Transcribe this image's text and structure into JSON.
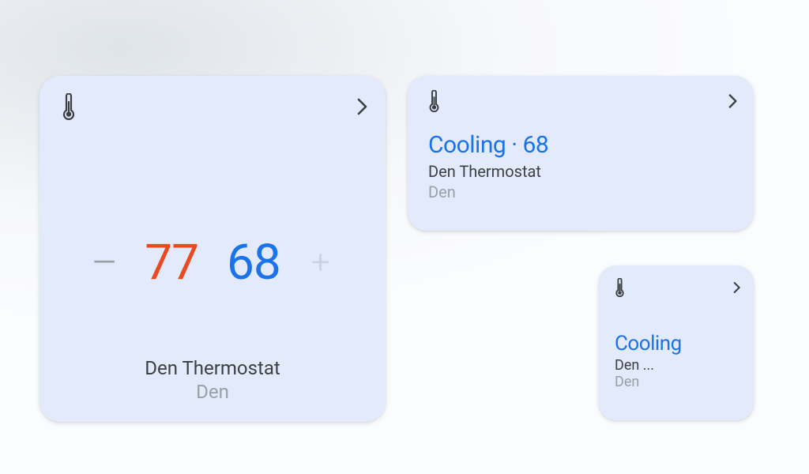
{
  "colors": {
    "card_bg": "#e3eafb",
    "blue": "#1a73e8",
    "orange": "#ea4a1f",
    "text_primary": "#3c4043",
    "text_muted": "#9aa0a6"
  },
  "icons": {
    "thermostat": "thermostat-icon",
    "chevron": "chevron-right-icon",
    "minus": "minus-icon",
    "plus": "plus-icon"
  },
  "large_card": {
    "minus_glyph": "–",
    "plus_glyph": "+",
    "temp_heat": "77",
    "temp_cool": "68",
    "device_name": "Den Thermostat",
    "room": "Den"
  },
  "medium_card": {
    "status_line": "Cooling · 68",
    "device_name": "Den Thermostat",
    "room": "Den"
  },
  "small_card": {
    "status_line": "Cooling",
    "device_name": "Den ...",
    "room": "Den"
  }
}
